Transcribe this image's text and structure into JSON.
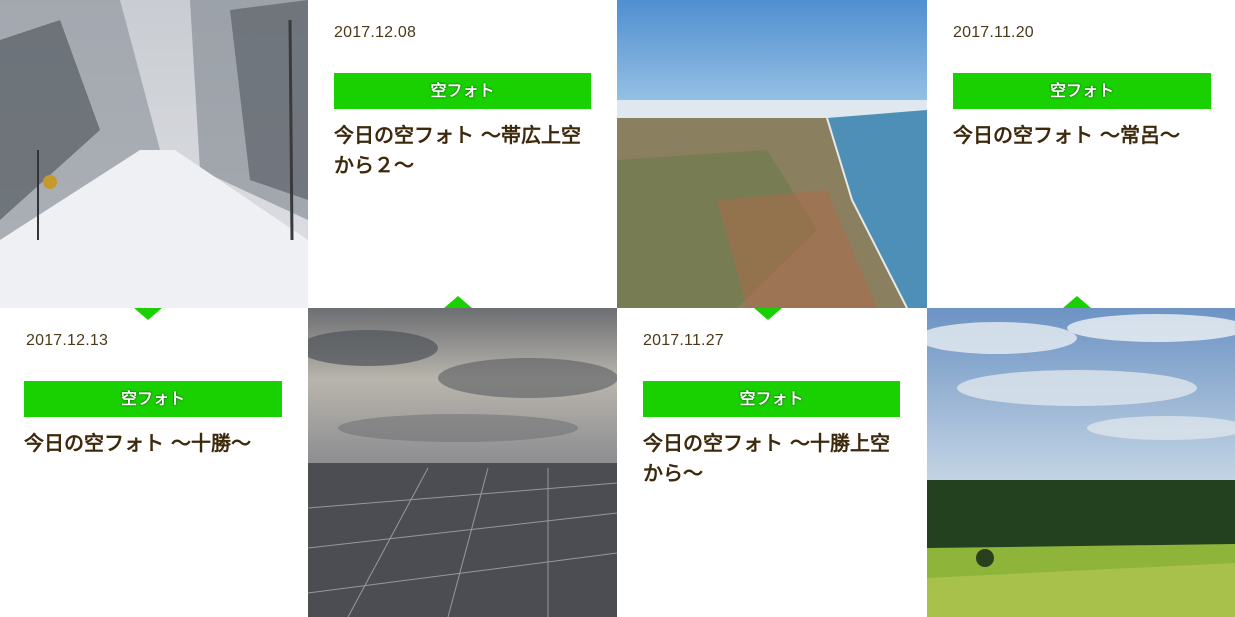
{
  "posts": [
    {
      "date": "2017.12.08",
      "category": "空フォト",
      "title": "今日の空フォト ～帯広上空から２～"
    },
    {
      "date": "2017.11.20",
      "category": "空フォト",
      "title": "今日の空フォト ～常呂～"
    },
    {
      "date": "2017.12.13",
      "category": "空フォト",
      "title": "今日の空フォト ～十勝～"
    },
    {
      "date": "2017.11.27",
      "category": "空フォト",
      "title": "今日の空フォト ～十勝上空から～"
    }
  ],
  "colors": {
    "accent": "#19d100",
    "title_text": "#3d2a0d",
    "date_text": "#4a3a1a"
  }
}
